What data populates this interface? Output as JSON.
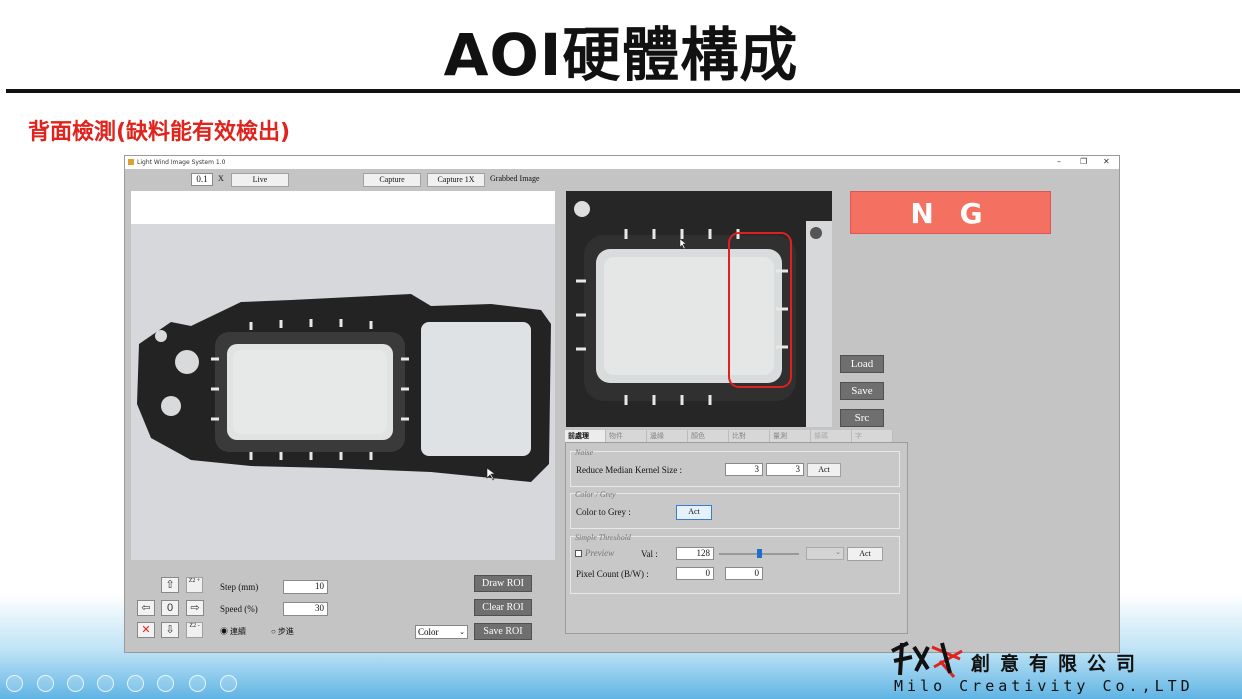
{
  "slide": {
    "title": "AOI硬體構成",
    "subtitle": "背面檢測(缺料能有效檢出)"
  },
  "app": {
    "window_title": "Light Wind Image System 1.0",
    "exposure_value": "0.1",
    "exposure_unit": "X",
    "live_label": "Live",
    "capture_label": "Capture",
    "capture1x_label": "Capture 1X",
    "grabbed_label": "Grabbed Image",
    "result": "N G",
    "load_label": "Load",
    "save_label": "Save",
    "src_label": "Src",
    "tabs": [
      "前處理",
      "物件",
      "邊緣",
      "顏色",
      "比對",
      "量測",
      "條碼",
      "字"
    ],
    "noise": {
      "title": "Noise",
      "label": "Reduce Median Kernel Size :",
      "val1": "3",
      "val2": "3",
      "act": "Act"
    },
    "color_grey": {
      "title": "Color / Grey",
      "label": "Color to Grey :",
      "act": "Act"
    },
    "threshold": {
      "title": "Simple Threshold",
      "preview_label": "Preview",
      "val_label": "Val :",
      "val": "128",
      "act": "Act",
      "pixel_label": "Pixel Count (B/W) :",
      "pixel_black": "0",
      "pixel_white": "0",
      "slider_level": 0.5
    },
    "motion": {
      "z2_plus": "Z2 +",
      "z2_minus": "Z2 -",
      "zero": "0",
      "step_label": "Step (mm)",
      "step_value": "10",
      "speed_label": "Speed (%)",
      "speed_value": "30",
      "mode_continuous": "連續",
      "mode_step": "步進"
    },
    "draw_roi_label": "Draw ROI",
    "clear_roi_label": "Clear ROI",
    "save_roi_label": "Save ROI",
    "color_select": "Color"
  },
  "logo": {
    "cn": "創意有限公司",
    "en": "Milo Creativity Co.,LTD"
  },
  "colors": {
    "title_red": "#e0231d",
    "ng_bg": "#f47060",
    "defect_box": "#e02020"
  }
}
